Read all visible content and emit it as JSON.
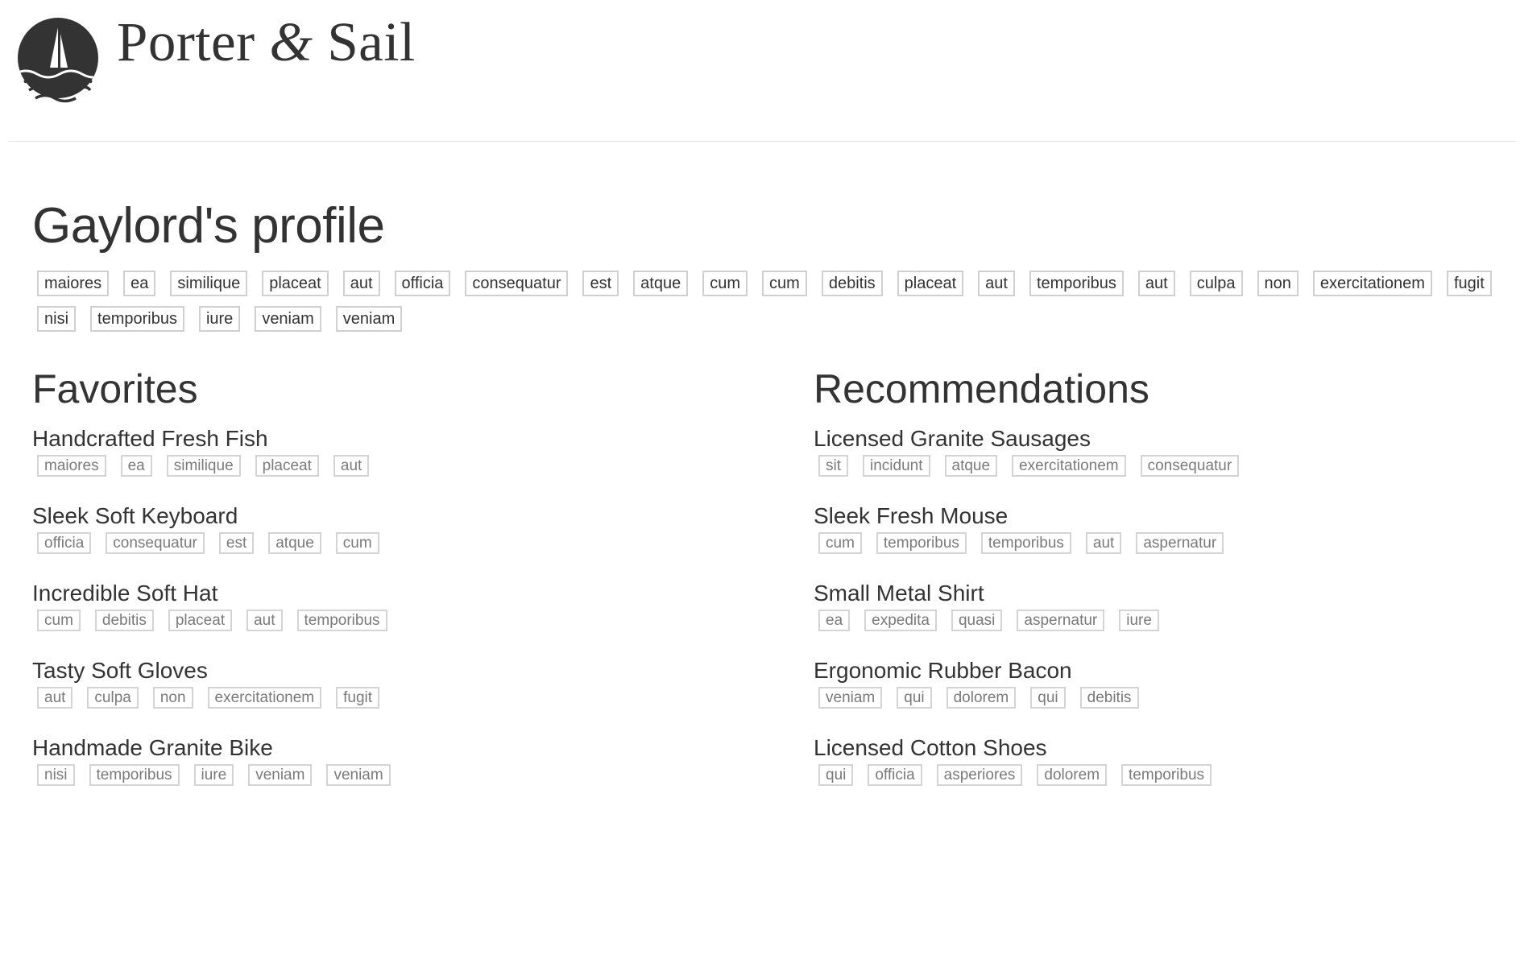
{
  "brand": {
    "name_part1": "Porter",
    "ampersand": "&",
    "name_part2": "Sail",
    "logo_icon": "sailboat-waves-icon"
  },
  "profile": {
    "title": "Gaylord's profile",
    "tags": [
      "maiores",
      "ea",
      "similique",
      "placeat",
      "aut",
      "officia",
      "consequatur",
      "est",
      "atque",
      "cum",
      "cum",
      "debitis",
      "placeat",
      "aut",
      "temporibus",
      "aut",
      "culpa",
      "non",
      "exercitationem",
      "fugit",
      "nisi",
      "temporibus",
      "iure",
      "veniam",
      "veniam"
    ]
  },
  "favorites": {
    "title": "Favorites",
    "items": [
      {
        "name": "Handcrafted Fresh Fish",
        "tags": [
          "maiores",
          "ea",
          "similique",
          "placeat",
          "aut"
        ]
      },
      {
        "name": "Sleek Soft Keyboard",
        "tags": [
          "officia",
          "consequatur",
          "est",
          "atque",
          "cum"
        ]
      },
      {
        "name": "Incredible Soft Hat",
        "tags": [
          "cum",
          "debitis",
          "placeat",
          "aut",
          "temporibus"
        ]
      },
      {
        "name": "Tasty Soft Gloves",
        "tags": [
          "aut",
          "culpa",
          "non",
          "exercitationem",
          "fugit"
        ]
      },
      {
        "name": "Handmade Granite Bike",
        "tags": [
          "nisi",
          "temporibus",
          "iure",
          "veniam",
          "veniam"
        ]
      }
    ]
  },
  "recommendations": {
    "title": "Recommendations",
    "items": [
      {
        "name": "Licensed Granite Sausages",
        "tags": [
          "sit",
          "incidunt",
          "atque",
          "exercitationem",
          "consequatur"
        ]
      },
      {
        "name": "Sleek Fresh Mouse",
        "tags": [
          "cum",
          "temporibus",
          "temporibus",
          "aut",
          "aspernatur"
        ]
      },
      {
        "name": "Small Metal Shirt",
        "tags": [
          "ea",
          "expedita",
          "quasi",
          "aspernatur",
          "iure"
        ]
      },
      {
        "name": "Ergonomic Rubber Bacon",
        "tags": [
          "veniam",
          "qui",
          "dolorem",
          "qui",
          "debitis"
        ]
      },
      {
        "name": "Licensed Cotton Shoes",
        "tags": [
          "qui",
          "officia",
          "asperiores",
          "dolorem",
          "temporibus"
        ]
      }
    ]
  },
  "colors": {
    "text": "#333333",
    "tag_border": "#d0d0d0",
    "muted_tag_text": "#7a7a7a",
    "divider": "#e3e3e3"
  }
}
